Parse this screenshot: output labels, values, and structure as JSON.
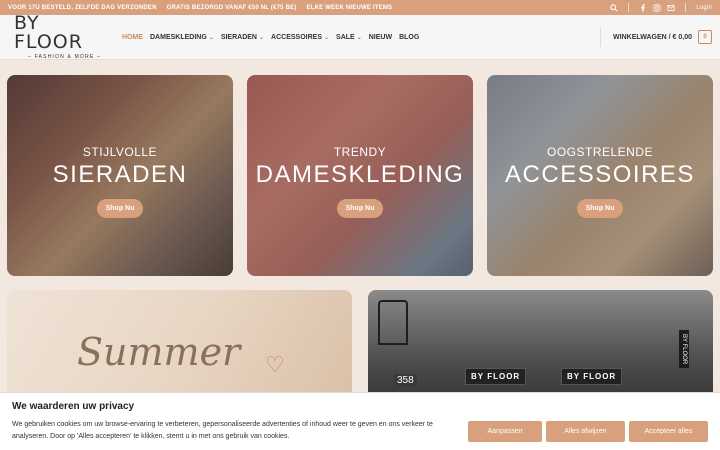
{
  "topbar": {
    "messages": [
      "VOOR 17U BESTELD, ZELFDE DAG VERZONDEN",
      "GRATIS BEZORGD VANAF €50 NL (€75 BE)",
      "ELKE WEEK NIEUWE ITEMS"
    ],
    "login": "Login"
  },
  "header": {
    "logo_main": "BY FLOOR",
    "logo_sub": "– FASHION & MORE –",
    "nav": [
      {
        "label": "HOME",
        "active": true
      },
      {
        "label": "DAMESKLEDING",
        "dropdown": true
      },
      {
        "label": "SIERADEN",
        "dropdown": true
      },
      {
        "label": "ACCESSOIRES",
        "dropdown": true
      },
      {
        "label": "SALE",
        "dropdown": true
      },
      {
        "label": "NIEUW"
      },
      {
        "label": "BLOG"
      }
    ],
    "cart_label": "WINKELWAGEN / € 0,00",
    "cart_count": "0"
  },
  "cards": [
    {
      "pre": "STIJLVOLLE",
      "title": "SIERADEN",
      "button": "Shop Nu"
    },
    {
      "pre": "TRENDY",
      "title": "DAMESKLEDING",
      "button": "Shop Nu"
    },
    {
      "pre": "OOGSTRELENDE",
      "title": "ACCESSOIRES",
      "button": "Shop Nu"
    }
  ],
  "bottom": {
    "summer_text": "Summer",
    "house_number": "358",
    "sign": "BY FLOOR",
    "vertical_sign": "BY FLOOR"
  },
  "cookie": {
    "title": "We waarderen uw privacy",
    "text": "We gebruiken cookies om uw browse-ervaring te verbeteren, gepersonaliseerde advertenties of inhoud weer te geven en ons verkeer te analyseren. Door op 'Alles accepteren' te klikken, stemt u in met ons gebruik van cookies.",
    "btn_customize": "Aanpassen",
    "btn_reject": "Alles afwijzen",
    "btn_accept": "Accepteer alles"
  },
  "colors": {
    "accent": "#d8a07c",
    "active_nav": "#c98b5c",
    "background": "#f2e8e0"
  }
}
